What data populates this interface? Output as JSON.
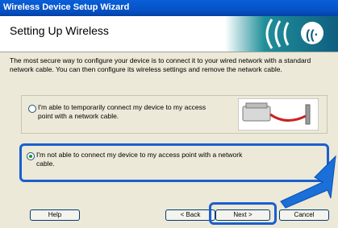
{
  "window": {
    "title": "Wireless Device Setup Wizard"
  },
  "header": {
    "title": "Setting Up Wireless",
    "logo_icon": "wireless-signal-icon"
  },
  "intro_text": "The most secure way to configure your device is to connect it to your wired network with a standard network cable. You can then configure its wireless settings and remove the network cable.",
  "options": [
    {
      "label": "I'm able to temporarily connect my device to my access point with a network cable.",
      "selected": false
    },
    {
      "label": "I'm not able to connect my device to my access point with a network cable.",
      "selected": true
    }
  ],
  "buttons": {
    "help": "Help",
    "back": "< Back",
    "next": "Next >",
    "cancel": "Cancel"
  },
  "colors": {
    "highlight": "#1a5fcf",
    "titlebar": "#0a5fd8"
  }
}
